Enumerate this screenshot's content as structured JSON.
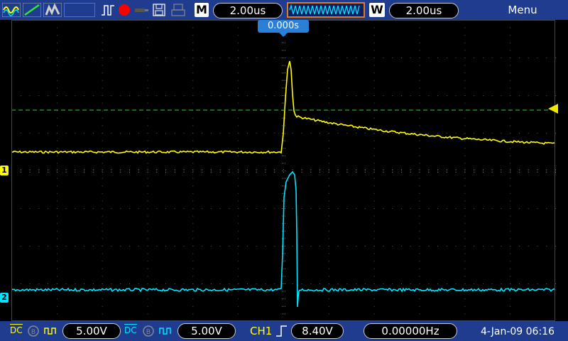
{
  "top_bar": {
    "icons": [
      "yellow-waveform-icon",
      "green-ramp-icon",
      "gray-persistence-icon",
      "run-mode-icon",
      "record-dot-icon",
      "probe-icon",
      "save-disk-icon",
      "print-icon"
    ],
    "timebase_tag": "M",
    "timebase_value": "2.00us",
    "window_tag": "W",
    "window_value": "2.00us",
    "menu_label": "Menu"
  },
  "trigger_position_label": "0.000s",
  "channel1": {
    "marker": "1",
    "color": "#ffff00"
  },
  "channel2": {
    "marker": "2",
    "color": "#00e5ff"
  },
  "trigger_level_marker_color": "#f2e600",
  "bottom_bar": {
    "ch1_coupling": "DC",
    "ch1_scale": "5.00V",
    "ch2_coupling": "DC",
    "ch2_scale": "5.00V",
    "trigger_source": "CH1",
    "trigger_level": "8.40V",
    "frequency": "0.00000Hz",
    "datetime": "4-Jan-09 06:16"
  },
  "colors": {
    "bar_bg": "#1f3c8f",
    "accent_orange": "#e07a1f",
    "record_red": "#ff0000"
  }
}
